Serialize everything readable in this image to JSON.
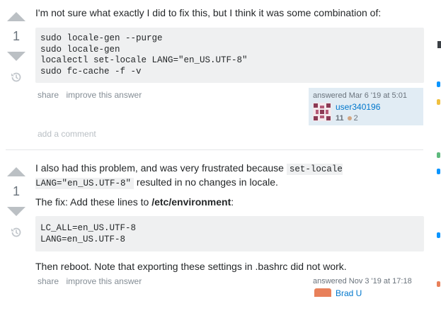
{
  "answers": [
    {
      "vote_count": "1",
      "intro": "I'm not sure what exactly I did to fix this, but I think it was some combination of:",
      "code": "sudo locale-gen --purge\nsudo locale-gen\nlocalectl set-locale LANG=\"en_US.UTF-8\"\nsudo fc-cache -f -v",
      "menu": {
        "share": "share",
        "improve": "improve this answer"
      },
      "signature": {
        "action": "answered Mar 6 '19 at 5:01",
        "user": "user340196",
        "reputation": "11",
        "bronze": "2"
      },
      "add_comment": "add a comment"
    },
    {
      "vote_count": "1",
      "p1_before": "I also had this problem, and was very frustrated because ",
      "p1_code": "set-locale LANG=\"en_US.UTF-8\"",
      "p1_after": " resulted in no changes in locale.",
      "p2_before": "The fix: Add these lines to ",
      "p2_bold": "/etc/environment",
      "p2_after": ":",
      "code": "LC_ALL=en_US.UTF-8\nLANG=en_US.UTF-8",
      "p3": "Then reboot. Note that exporting these settings in .bashrc did not work.",
      "menu": {
        "share": "share",
        "improve": "improve this answer"
      },
      "signature": {
        "action": "answered Nov 3 '19 at 17:18",
        "user": "Brad U"
      }
    }
  ],
  "colors": {
    "link": "#0077cc",
    "vote_arrow": "#bbc0c4",
    "code_bg": "#eff0f1",
    "signature_bg": "#e1ecf4"
  }
}
